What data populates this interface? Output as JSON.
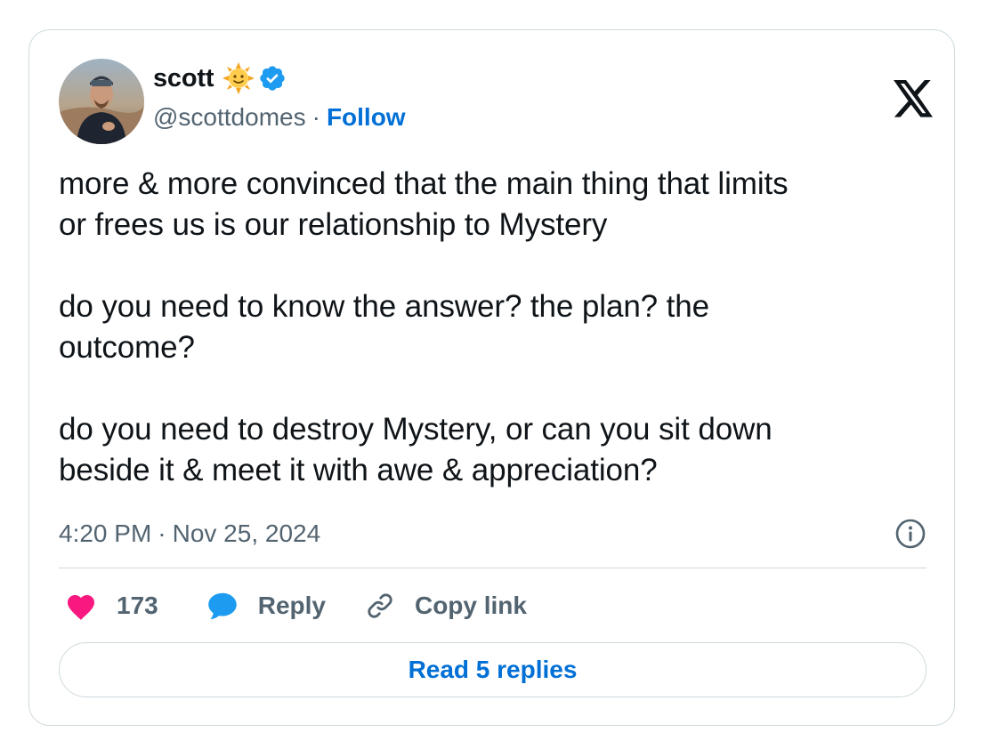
{
  "author": {
    "display_name": "scott",
    "name_emoji": "sun-with-face-emoji",
    "verified": true,
    "handle": "@scottdomes",
    "separator": "·",
    "follow_label": "Follow"
  },
  "tweet": {
    "paragraphs": [
      "more & more convinced that the main thing that limits\nor frees us is our relationship to Mystery",
      "do you need to know the answer? the plan? the\noutcome?",
      "do you need to destroy Mystery, or can you sit down\nbeside it & meet it with awe & appreciation?"
    ],
    "time": "4:20 PM",
    "date_separator": "·",
    "date": "Nov 25, 2024"
  },
  "actions": {
    "like_count": "173",
    "reply_label": "Reply",
    "copy_link_label": "Copy link"
  },
  "read_replies_label": "Read 5 replies",
  "icons": {
    "brand": "x-logo-icon",
    "info": "info-icon",
    "like": "heart-icon",
    "reply": "speech-bubble-icon",
    "copy": "link-icon",
    "verified": "verified-badge-icon"
  },
  "colors": {
    "text_primary": "#0f1419",
    "text_secondary": "#536471",
    "link_blue": "#006fd6",
    "verified_blue": "#1d9bf0",
    "like_pink": "#f91880",
    "border": "#cfd9de"
  }
}
